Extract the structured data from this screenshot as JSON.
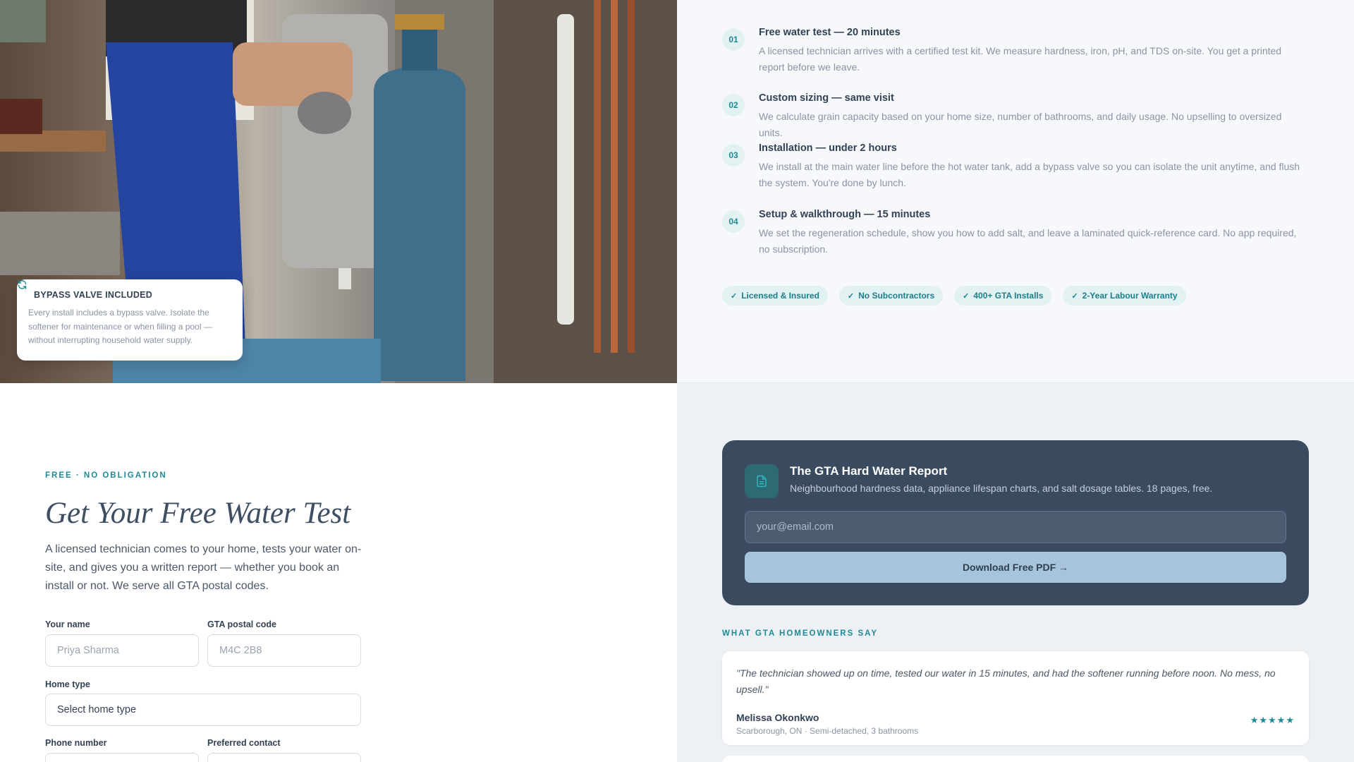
{
  "hero_image": {
    "bypass_card": {
      "title": "BYPASS VALVE INCLUDED",
      "body": "Every install includes a bypass valve. Isolate the softener for maintenance or when filling a pool — without interrupting household water supply."
    }
  },
  "steps": [
    {
      "number": "01",
      "title": "Free water test — 20 minutes",
      "desc": "A licensed technician arrives with a certified test kit. We measure hardness, iron, pH, and TDS on-site. You get a printed report before we leave."
    },
    {
      "number": "02",
      "title": "Custom sizing — same visit",
      "desc": "We calculate grain capacity based on your home size, number of bathrooms, and daily usage. No upselling to oversized units."
    },
    {
      "number": "03",
      "title": "Installation — under 2 hours",
      "desc": "We install at the main water line before the hot water tank, add a bypass valve so you can isolate the unit anytime, and flush the system. You're done by lunch."
    },
    {
      "number": "04",
      "title": "Setup & walkthrough — 15 minutes",
      "desc": "We set the regeneration schedule, show you how to add salt, and leave a laminated quick-reference card. No app required, no subscription."
    }
  ],
  "badges": [
    "Licensed & Insured",
    "No Subcontractors",
    "400+ GTA Installs",
    "2-Year Labour Warranty"
  ],
  "form": {
    "eyebrow": "FREE · NO OBLIGATION",
    "title": "Get Your Free Water Test",
    "lede": "A licensed technician comes to your home, tests your water on-site, and gives you a written report — whether you book an install or not. We serve all GTA postal codes.",
    "name_label": "Your name",
    "name_placeholder": "Priya Sharma",
    "postal_label": "GTA postal code",
    "postal_placeholder": "M4C 2B8",
    "home_type_label": "Home type",
    "home_type_value": "Select home type",
    "phone_label": "Phone number",
    "contact_label": "Preferred contact"
  },
  "report": {
    "title": "The GTA Hard Water Report",
    "subtitle": "Neighbourhood hardness data, appliance lifespan charts, and salt dosage tables. 18 pages, free.",
    "email_placeholder": "your@email.com",
    "button": "Download Free PDF →"
  },
  "testimonials": {
    "eyebrow": "WHAT GTA HOMEOWNERS SAY",
    "items": [
      {
        "quote": "\"The technician showed up on time, tested our water in 15 minutes, and had the softener running before noon. No mess, no upsell.\"",
        "name": "Melissa Okonkwo",
        "meta": "Scarborough, ON · Semi-detached, 3 bathrooms",
        "stars": "★★★★★"
      }
    ]
  },
  "colors": {
    "accent": "#1f8a96",
    "dark_card": "#3b4b5f",
    "button": "#a8c4da"
  }
}
